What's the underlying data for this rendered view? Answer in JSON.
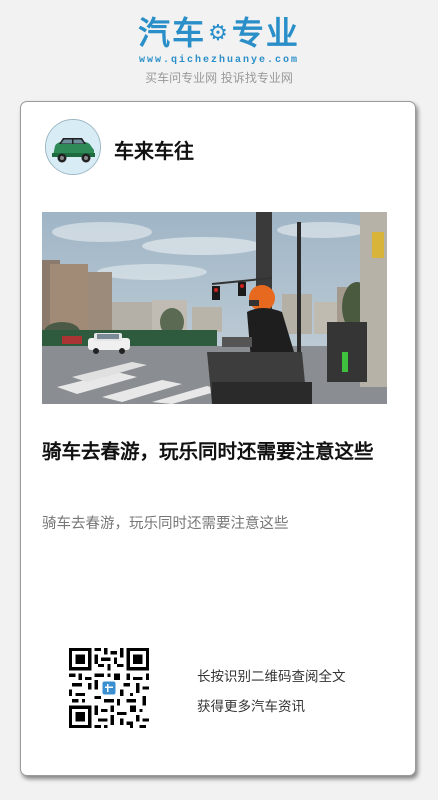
{
  "brand": {
    "name_part1": "汽车",
    "name_part2": "专业",
    "domain": "www.qichezhuanye.com",
    "tagline": "买车问专业网 投诉找专业网"
  },
  "card": {
    "author": "车来车往",
    "title": "骑车去春游，玩乐同时还需要注意这些",
    "summary": "骑车去春游，玩乐同时还需要注意这些",
    "qr_hint_line1": "长按识别二维码查阅全文",
    "qr_hint_line2": "获得更多汽车资讯"
  },
  "colors": {
    "brand_blue": "#2a8fc9",
    "card_bg": "#ffffff",
    "page_bg": "#f2f2f2"
  },
  "icons": {
    "brand_gear": "gear-icon",
    "avatar": "green-car-avatar",
    "qr": "qr-code"
  }
}
